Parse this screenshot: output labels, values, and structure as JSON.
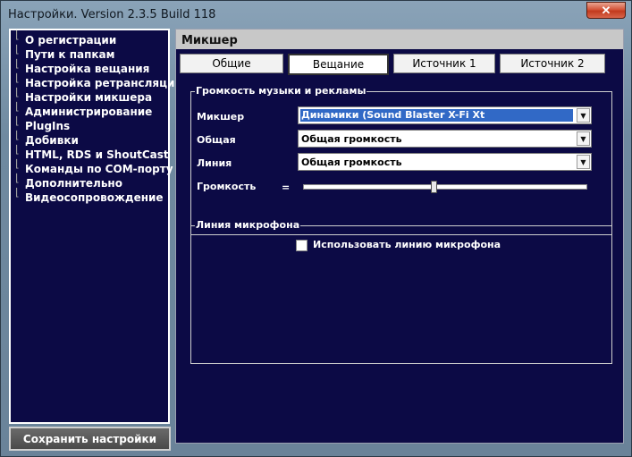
{
  "window": {
    "title": "Настройки. Version 2.3.5 Build 118",
    "close_glyph": "✕"
  },
  "sidebar": {
    "items": [
      {
        "label": "О регистрации"
      },
      {
        "label": "Пути к папкам"
      },
      {
        "label": "Настройка вещания"
      },
      {
        "label": "Настройка ретрансляции"
      },
      {
        "label": "Настройки микшера"
      },
      {
        "label": "Администрирование"
      },
      {
        "label": "PlugIns"
      },
      {
        "label": "Добивки"
      },
      {
        "label": "HTML, RDS и ShoutCast"
      },
      {
        "label": "Команды по COM-порту"
      },
      {
        "label": "Дополнительно"
      },
      {
        "label": "Видеосопровождение"
      }
    ],
    "save_label": "Сохранить настройки"
  },
  "main": {
    "title": "Микшер",
    "tabs": [
      {
        "label": "Общие"
      },
      {
        "label": "Вещание",
        "active": true
      },
      {
        "label": "Источник 1"
      },
      {
        "label": "Источник 2"
      }
    ],
    "music_group": {
      "title": "Громкость музыки и рекламы",
      "mixer_label": "Микшер",
      "mixer_value": "Динамики (Sound Blaster X-Fi Xt",
      "general_label": "Общая",
      "general_value": "Общая громкость",
      "line_label": "Линия",
      "line_value": "Общая громкость",
      "volume_label": "Громкость",
      "volume_sign": "=",
      "volume_level_fraction": 0.46
    },
    "mic_group": {
      "title": "Линия микрофона",
      "use_mic_label": "Использовать линию микрофона",
      "use_mic_checked": false
    }
  },
  "colors": {
    "panel_bg": "#0c0a45",
    "selection": "#3169c6",
    "close": "#c23a1e"
  },
  "icons": {
    "close": "close-icon",
    "dropdown": "chevron-down-icon",
    "dash": "tree-line-icon"
  }
}
